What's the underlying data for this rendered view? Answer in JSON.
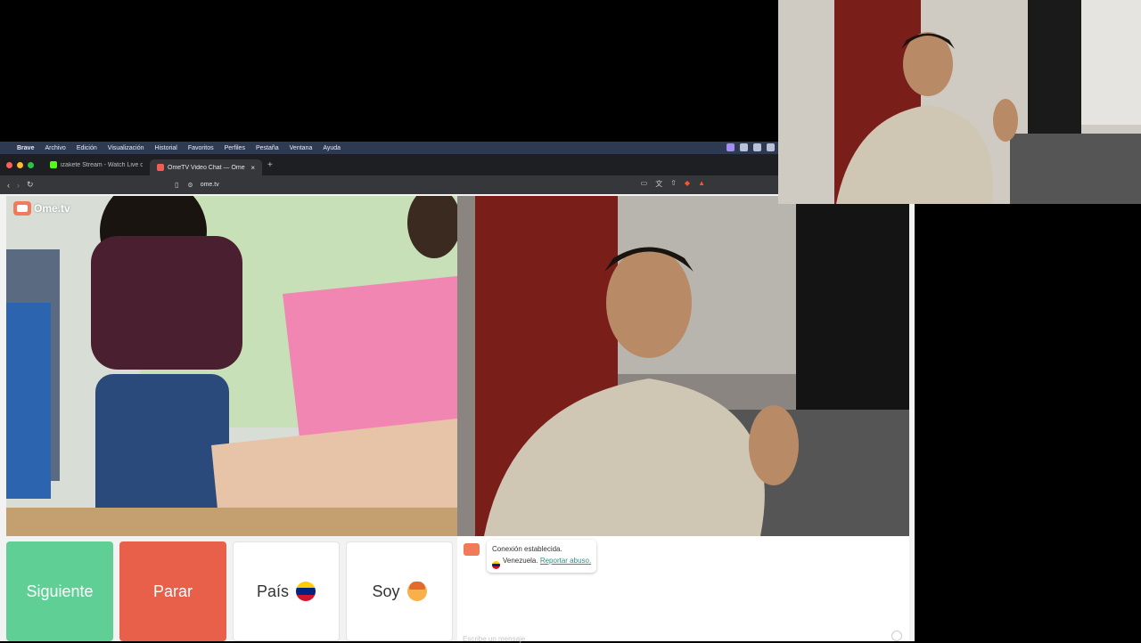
{
  "menubar": {
    "items": [
      "Brave",
      "Archivo",
      "Edición",
      "Visualización",
      "Historial",
      "Favoritos",
      "Perfiles",
      "Pestaña",
      "Ventana",
      "Ayuda"
    ]
  },
  "tabs": [
    {
      "title": "izakete Stream - Watch Live on Ki",
      "favicon_color": "#53fc18"
    },
    {
      "title": "OmeTV Video Chat — Ome",
      "favicon_color": "#f25c54"
    }
  ],
  "address_bar": {
    "url": "ome.tv"
  },
  "site": {
    "logo_text": "Ome.tv"
  },
  "buttons": {
    "next": "Siguiente",
    "stop": "Parar",
    "country": "País",
    "gender": "Soy"
  },
  "chat": {
    "connection_msg": "Conexión establecida.",
    "country": "Venezuela.",
    "report_link": "Reportar abuso.",
    "input_placeholder": "Escribe un mensaje"
  },
  "colors": {
    "next_button": "#5fcf96",
    "stop_button": "#e8604a",
    "flag_venezuela": [
      "#ffcc00",
      "#00247d",
      "#cf142b"
    ]
  }
}
